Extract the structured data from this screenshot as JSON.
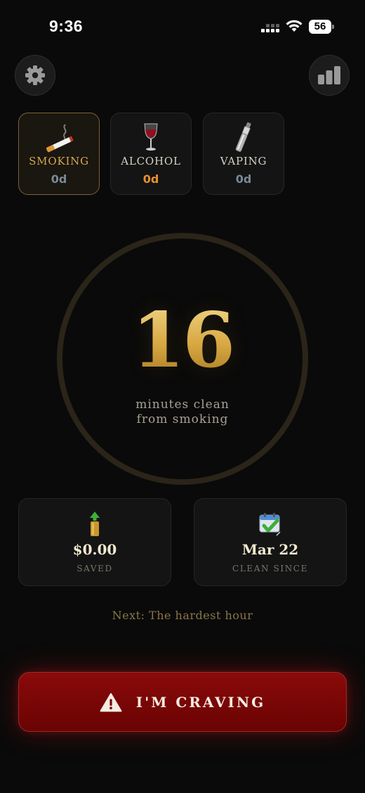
{
  "status_bar": {
    "time": "9:36",
    "battery": "56"
  },
  "header": {
    "settings_icon": "gear-icon",
    "stats_icon": "bar-chart-icon"
  },
  "tabs": [
    {
      "label": "SMOKING",
      "count": "0d",
      "icon": "cigarette-icon",
      "active": true
    },
    {
      "label": "ALCOHOL",
      "count": "0d",
      "icon": "wine-glass-icon",
      "active": false
    },
    {
      "label": "VAPING",
      "count": "0d",
      "icon": "vape-pen-icon",
      "active": false
    }
  ],
  "timer": {
    "value": "16",
    "caption_line1": "minutes clean",
    "caption_line2": "from smoking"
  },
  "stats": {
    "saved": {
      "value": "$0.00",
      "label": "SAVED",
      "icon": "money-up-icon"
    },
    "clean_since": {
      "value": "Mar 22",
      "label": "CLEAN SINCE",
      "icon": "calendar-check-icon"
    }
  },
  "next_milestone": "Next: The hardest hour",
  "craving_button": {
    "label": "I'M CRAVING",
    "icon": "warning-icon"
  },
  "colors": {
    "gold": "#d4a94e",
    "ring": "#2a2518",
    "craving_red": "#7a0606",
    "background": "#0a0a0a"
  }
}
